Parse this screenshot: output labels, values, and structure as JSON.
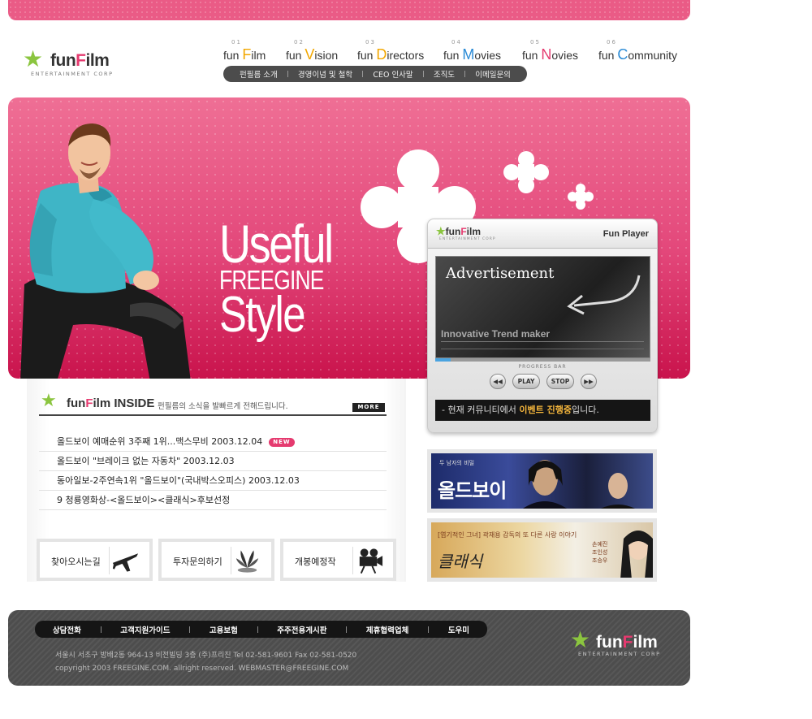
{
  "brand": {
    "name_prefix": "fun",
    "name_f": "F",
    "name_rest": "ilm",
    "tagline": "ENTERTAINMENT CORP"
  },
  "gnb": [
    {
      "num": "01",
      "pre": "fun ",
      "cap": "F",
      "rest": "ilm",
      "color": "#f2a700"
    },
    {
      "num": "02",
      "pre": "fun ",
      "cap": "V",
      "rest": "ision",
      "color": "#f2a700"
    },
    {
      "num": "03",
      "pre": "fun ",
      "cap": "D",
      "rest": "irectors",
      "color": "#f2a700"
    },
    {
      "num": "04",
      "pre": "fun ",
      "cap": "M",
      "rest": "ovies",
      "color": "#2b8bd6"
    },
    {
      "num": "05",
      "pre": "fun ",
      "cap": "N",
      "rest": "ovies",
      "color": "#e53a6f"
    },
    {
      "num": "06",
      "pre": "fun ",
      "cap": "C",
      "rest": "ommunity",
      "color": "#2b8bd6"
    }
  ],
  "subnav": [
    "펀필름 소개",
    "경영이념 및 철학",
    "CEO 인사말",
    "조직도",
    "이메일문의"
  ],
  "hero": {
    "line1": "Useful",
    "line2": "FREEGINE",
    "line3": "Style"
  },
  "player": {
    "title": "Fun Player",
    "ad_title": "Advertisement",
    "trend": "Innovative Trend maker",
    "progress_label": "PROGRESS BAR",
    "progress": 0.07,
    "btn_prev": "◀◀",
    "btn_play": "PLAY",
    "btn_stop": "STOP",
    "btn_next": "▶▶",
    "ticker_pre": "- 현재 커뮤니티에서 ",
    "ticker_hl": "이벤트 진행중",
    "ticker_post": "입니다."
  },
  "inside": {
    "title": "INSIDE",
    "desc": "펀필름의 소식을 발빠르게 전해드립니다.",
    "more": "MORE",
    "news": [
      {
        "text": "올드보이 예매순위 3주째 1위...맥스무비  2003.12.04",
        "badge": "NEW"
      },
      {
        "text": "올드보이 \"브레이크 없는 자동차\" 2003.12.03",
        "badge": ""
      },
      {
        "text": "동아일보-2주연속1위 \"올드보이\"(국내박스오피스) 2003.12.03",
        "badge": ""
      },
      {
        "text": "9 청룡영화상-<올드보이><클래식>후보선정",
        "badge": ""
      }
    ]
  },
  "quick": [
    {
      "label": "찾아오시는길",
      "icon": "airplane-icon"
    },
    {
      "label": "투자문의하기",
      "icon": "plant-icon"
    },
    {
      "label": "개봉예정작",
      "icon": "movie-camera-icon"
    }
  ],
  "banners": {
    "b1_small": "두 남자의 비밀",
    "b1_title": "올드보이",
    "b2_small": "[엽기적인 그녀] 곽재용 감독의 또 다른 사랑 이야기",
    "b2_title": "클래식",
    "b2_cast": [
      "손예진",
      "조인성",
      "조승우"
    ]
  },
  "footer": {
    "nav": [
      "상담전화",
      "고객지원가이드",
      "고용보험",
      "주주전용게시판",
      "제휴협력업체",
      "도우미"
    ],
    "address": "서울시 서초구 방배2동 964-13 비전빌딩 3층 (주)프리진    Tel 02-581-9601   Fax 02-581-0520",
    "copyright": "copyright 2003 FREEGINE.COM.  allright reserved.      WEBMASTER@FREEGINE.COM"
  }
}
